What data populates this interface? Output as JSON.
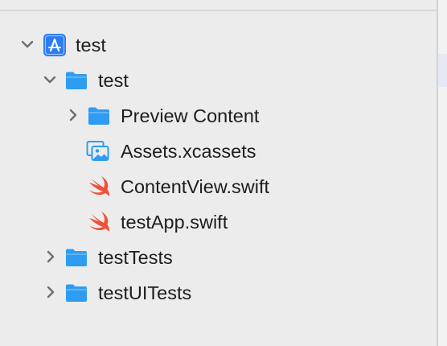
{
  "navigator": {
    "items": [
      {
        "label": "test",
        "kind": "project",
        "icon": "xcode-project-icon",
        "expanded": true,
        "depth": 0
      },
      {
        "label": "test",
        "kind": "folder",
        "icon": "folder-icon",
        "expanded": true,
        "depth": 1
      },
      {
        "label": "Preview Content",
        "kind": "folder",
        "icon": "folder-icon",
        "expanded": false,
        "depth": 2
      },
      {
        "label": "Assets.xcassets",
        "kind": "asset-catalog",
        "icon": "asset-catalog-icon",
        "depth": 2
      },
      {
        "label": "ContentView.swift",
        "kind": "swift-file",
        "icon": "swift-icon",
        "depth": 2
      },
      {
        "label": "testApp.swift",
        "kind": "swift-file",
        "icon": "swift-icon",
        "depth": 2
      },
      {
        "label": "testTests",
        "kind": "folder",
        "icon": "folder-icon",
        "expanded": false,
        "depth": 1
      },
      {
        "label": "testUITests",
        "kind": "folder",
        "icon": "folder-icon",
        "expanded": false,
        "depth": 1
      }
    ]
  },
  "colors": {
    "background": "#ececec",
    "folder": "#2e9cf0",
    "project": "#2a7cf4",
    "swift": "#f05138",
    "chevron": "#6e6e73",
    "text": "#1d1d1f"
  }
}
